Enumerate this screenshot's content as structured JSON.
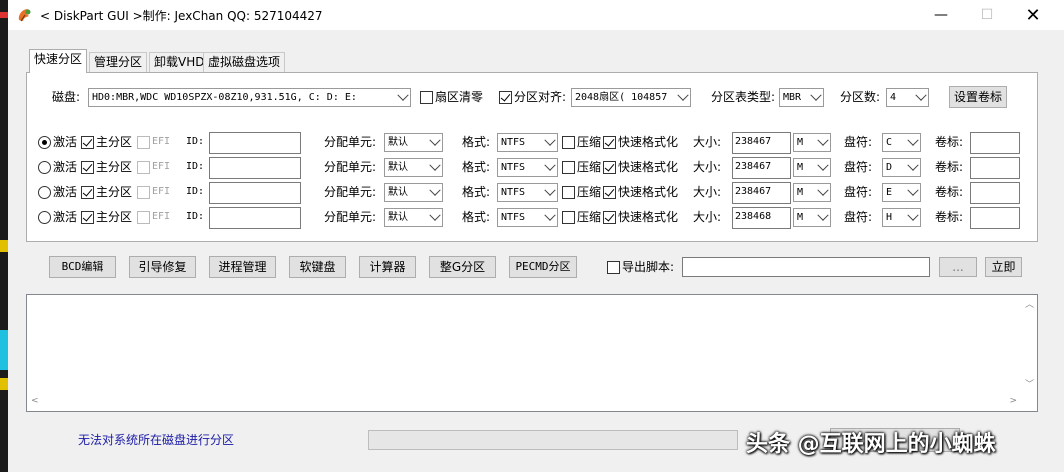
{
  "window": {
    "title": "< DiskPart GUI >制作: JexChan  QQ: 527104427",
    "controls": {
      "minimize": "—",
      "maximize": "☐",
      "close": "✕"
    }
  },
  "tabs": [
    {
      "label": "快速分区",
      "active": true
    },
    {
      "label": "管理分区",
      "active": false
    },
    {
      "label": "卸载VHD",
      "active": false
    },
    {
      "label": "虚拟磁盘选项",
      "active": false
    }
  ],
  "disk_row": {
    "disk_label": "磁盘:",
    "disk_value": "HD0:MBR,WDC WD10SPZX-08Z10,931.51G, C: D: E:",
    "sector_zero_label": "扇区清零",
    "sector_zero_checked": false,
    "align_label": "分区对齐:",
    "align_checked": true,
    "align_value": "2048扇区( 104857",
    "table_type_label": "分区表类型:",
    "table_type_value": "MBR",
    "count_label": "分区数:",
    "count_value": "4",
    "set_label_button": "设置卷标"
  },
  "partitions": [
    {
      "active_label": "激活",
      "active_selected": true,
      "primary_label": "主分区",
      "primary_checked": true,
      "efi_label": "EFI",
      "id_label": "ID:",
      "id_value": "",
      "unit_label": "分配单元:",
      "unit_value": "默认",
      "format_label": "格式:",
      "format_value": "NTFS",
      "compress_label": "压缩",
      "compress_checked": false,
      "quick_label": "快速格式化",
      "quick_checked": true,
      "size_label": "大小:",
      "size_value": "238467",
      "size_unit": "M",
      "drive_label": "盘符:",
      "drive_value": "C",
      "vol_label": "卷标:",
      "vol_value": ""
    },
    {
      "active_label": "激活",
      "active_selected": false,
      "primary_label": "主分区",
      "primary_checked": true,
      "efi_label": "EFI",
      "id_label": "ID:",
      "id_value": "",
      "unit_label": "分配单元:",
      "unit_value": "默认",
      "format_label": "格式:",
      "format_value": "NTFS",
      "compress_label": "压缩",
      "compress_checked": false,
      "quick_label": "快速格式化",
      "quick_checked": true,
      "size_label": "大小:",
      "size_value": "238467",
      "size_unit": "M",
      "drive_label": "盘符:",
      "drive_value": "D",
      "vol_label": "卷标:",
      "vol_value": ""
    },
    {
      "active_label": "激活",
      "active_selected": false,
      "primary_label": "主分区",
      "primary_checked": true,
      "efi_label": "EFI",
      "id_label": "ID:",
      "id_value": "",
      "unit_label": "分配单元:",
      "unit_value": "默认",
      "format_label": "格式:",
      "format_value": "NTFS",
      "compress_label": "压缩",
      "compress_checked": false,
      "quick_label": "快速格式化",
      "quick_checked": true,
      "size_label": "大小:",
      "size_value": "238467",
      "size_unit": "M",
      "drive_label": "盘符:",
      "drive_value": "E",
      "vol_label": "卷标:",
      "vol_value": ""
    },
    {
      "active_label": "激活",
      "active_selected": false,
      "primary_label": "主分区",
      "primary_checked": true,
      "efi_label": "EFI",
      "id_label": "ID:",
      "id_value": "",
      "unit_label": "分配单元:",
      "unit_value": "默认",
      "format_label": "格式:",
      "format_value": "NTFS",
      "compress_label": "压缩",
      "compress_checked": false,
      "quick_label": "快速格式化",
      "quick_checked": true,
      "size_label": "大小:",
      "size_value": "238468",
      "size_unit": "M",
      "drive_label": "盘符:",
      "drive_value": "H",
      "vol_label": "卷标:",
      "vol_value": ""
    }
  ],
  "tools": {
    "bcd": "BCD编辑",
    "boot_repair": "引导修复",
    "process_mgr": "进程管理",
    "soft_keyboard": "软键盘",
    "calculator": "计算器",
    "g_partition": "整G分区",
    "pecmd": "PECMD分区",
    "export_label": "导出脚本:",
    "export_checked": false,
    "export_path": "",
    "browse": "...",
    "run_now": "立即"
  },
  "log": {
    "text": ""
  },
  "status": {
    "message": "无法对系统所在磁盘进行分区",
    "progress": 0,
    "watermark": "头条 @互联网上的小蜘蛛"
  }
}
